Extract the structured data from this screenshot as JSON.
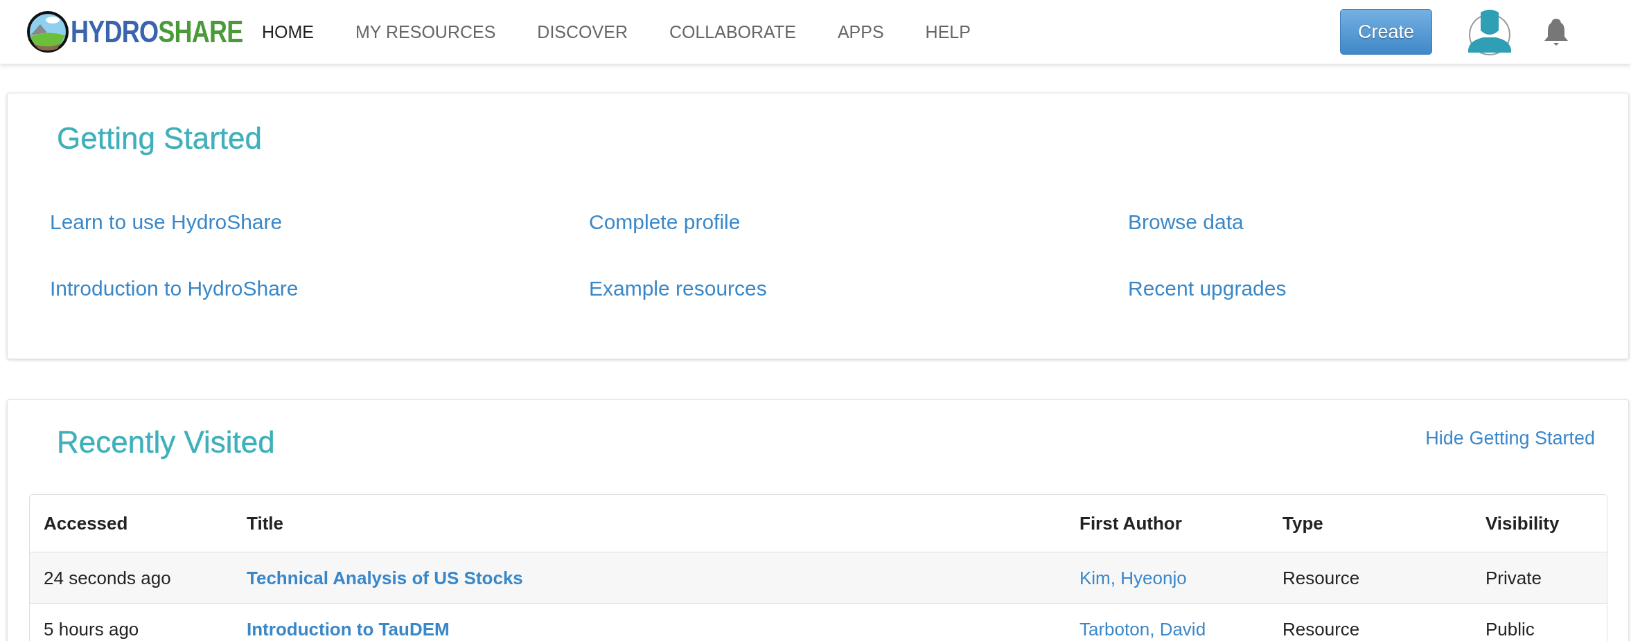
{
  "navbar": {
    "logo": {
      "part_1": "HYDRO",
      "part_2": "SHARE"
    },
    "items": [
      {
        "label": "HOME",
        "selected": true
      },
      {
        "label": "MY RESOURCES",
        "selected": false
      },
      {
        "label": "DISCOVER",
        "selected": false
      },
      {
        "label": "COLLABORATE",
        "selected": false
      },
      {
        "label": "APPS",
        "selected": false
      },
      {
        "label": "HELP",
        "selected": false
      }
    ],
    "create_button": "Create"
  },
  "getting_started": {
    "title": "Getting Started",
    "links": [
      "Learn to use HydroShare",
      "Complete profile",
      "Browse data",
      "Introduction to HydroShare",
      "Example resources",
      "Recent upgrades"
    ]
  },
  "recently_visited": {
    "title": "Recently Visited",
    "hide_link": "Hide Getting Started",
    "table": {
      "columns": [
        "Accessed",
        "Title",
        "First Author",
        "Type",
        "Visibility"
      ],
      "rows": [
        [
          "24 seconds ago",
          "Technical Analysis of US Stocks",
          "Kim, Hyeonjo",
          "Resource",
          "Private"
        ],
        [
          "5 hours ago",
          "Introduction to TauDEM",
          "Tarboton, David",
          "Resource",
          "Public"
        ]
      ]
    }
  }
}
